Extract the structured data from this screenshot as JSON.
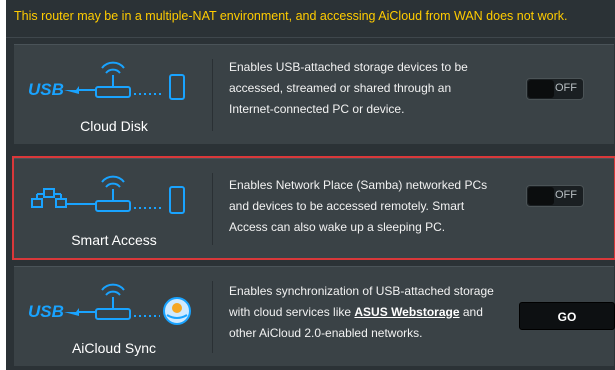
{
  "warning": {
    "text": "This router may be in a multiple-NAT environment, and accessing AiCloud from WAN does not work.",
    "color": "#ffcc00"
  },
  "cards": [
    {
      "title": "Cloud Disk",
      "description": "Enables USB-attached storage devices to be accessed, streamed or shared through an Internet-connected PC or device.",
      "control": "toggle",
      "toggle_label": "OFF",
      "icon": "usb-router-phone-icon"
    },
    {
      "title": "Smart Access",
      "description": "Enables Network Place (Samba) networked PCs and devices to be accessed remotely. Smart Access can also wake up a sleeping PC.",
      "control": "toggle",
      "toggle_label": "OFF",
      "icon": "network-router-phone-icon",
      "selected": true
    },
    {
      "title": "AiCloud Sync",
      "description_before": "Enables synchronization of USB-attached storage with cloud services like ",
      "description_link": "ASUS Webstorage",
      "description_after": " and other AiCloud 2.0-enabled networks.",
      "control": "button",
      "button_label": "GO",
      "icon": "usb-router-cloud-icon"
    }
  ],
  "colors": {
    "accent_blue": "#19a3ff",
    "selection_border": "#d9383a"
  }
}
